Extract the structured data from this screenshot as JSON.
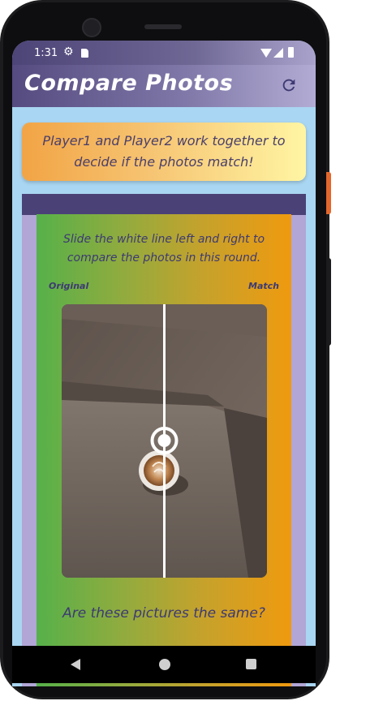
{
  "status_bar": {
    "time": "1:31",
    "icons": [
      "gear-icon",
      "sd-card-icon",
      "wifi-icon",
      "signal-icon",
      "battery-icon"
    ]
  },
  "app_bar": {
    "title": "Compare Photos",
    "refresh_icon": "refresh-icon"
  },
  "banner": {
    "text": "Player1 and Player2 work together to decide if the photos match!"
  },
  "compare": {
    "instructions": "Slide the white line left and right to compare the photos in this round.",
    "label_left": "Original",
    "label_right": "Match",
    "slider_position": 0.5,
    "question": "Are these pictures the same?"
  },
  "nav_bar": {
    "icons": [
      "back-icon",
      "home-icon",
      "recents-icon"
    ]
  },
  "colors": {
    "app_bar": "#564b80",
    "screen_bg": "#a9d6f2",
    "banner_start": "#f2a445",
    "banner_end": "#fff5a3",
    "panel_start": "#56b14a",
    "panel_end": "#ef9a0f",
    "frame": "#b1a6d6",
    "text": "#3d3a73"
  }
}
